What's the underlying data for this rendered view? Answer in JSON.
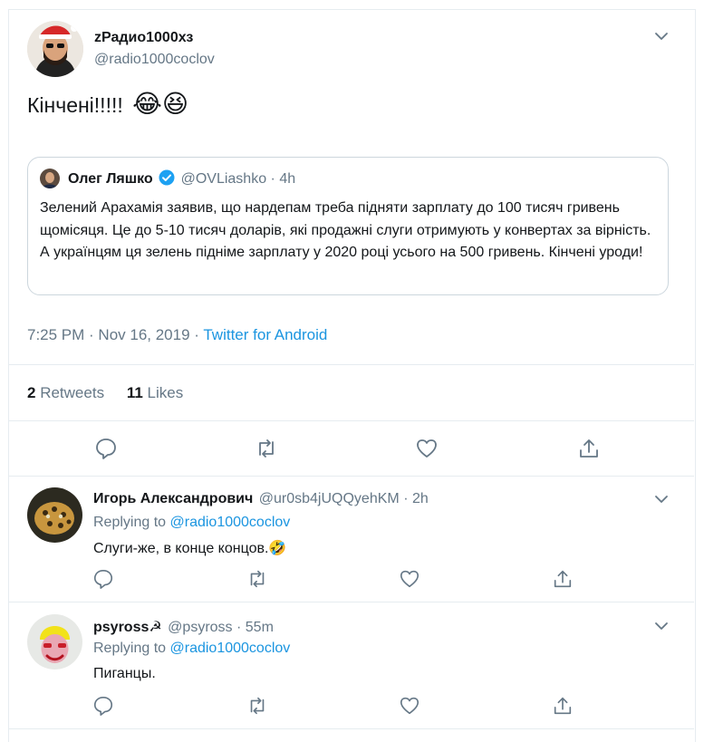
{
  "main_tweet": {
    "author_name": "zРадио1000хз",
    "author_handle": "@radio1000coclov",
    "text": "Кінчені!!!!!",
    "emojis": "😂😆",
    "timestamp": "7:25 PM · Nov 16, 2019 · ",
    "source": "Twitter for Android",
    "retweets_count": "2",
    "retweets_label": "Retweets",
    "likes_count": "11",
    "likes_label": "Likes"
  },
  "quoted_tweet": {
    "author_name": "Олег Ляшко",
    "author_handle": "@OVLiashko",
    "time": "· 4h",
    "verified": true,
    "text": "Зелений Арахамія заявив, що нардепам треба підняти зарплату до 100 тисяч гривень щомісяця. Це до 5-10 тисяч доларів, які продажні слуги отримують у конвертах за вірність. А українцям ця зелень підніме зарплату у 2020 році усього на 500 гривень. Кінчені уроди!"
  },
  "replies": [
    {
      "author_name": "Игорь Александрович",
      "author_handle": "@ur0sb4jUQQyehKM",
      "time": "· 2h",
      "replying_prefix": "Replying to ",
      "replying_to": "@radio1000coclov",
      "text": "Слуги-же, в конце концов.🤣"
    },
    {
      "author_name": "psyross☭",
      "author_handle": "@psyross",
      "time": "· 55m",
      "replying_prefix": "Replying to ",
      "replying_to": "@radio1000coclov",
      "text": "Пиганцы."
    }
  ],
  "colors": {
    "accent": "#1b95e0",
    "muted": "#657786",
    "border": "#e6ecf0",
    "text": "#14171a"
  },
  "icons": [
    "chevron-down-icon",
    "reply-icon",
    "retweet-icon",
    "like-icon",
    "share-icon",
    "verified-icon"
  ]
}
